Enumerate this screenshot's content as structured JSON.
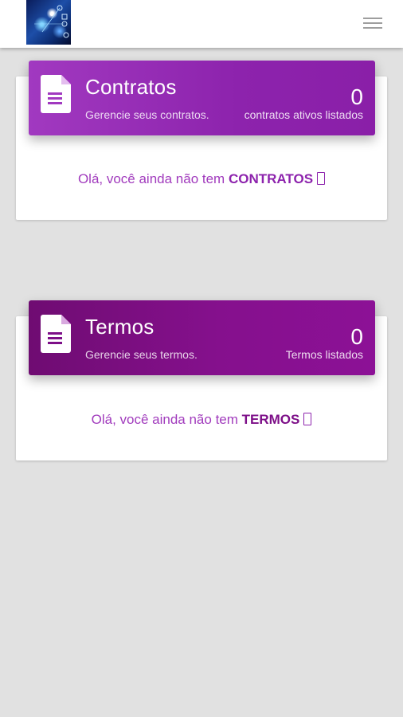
{
  "header": {
    "logo_icon": "app-logo",
    "menu_icon": "hamburger-menu-icon"
  },
  "cards": [
    {
      "id": "contratos",
      "title": "Contratos",
      "subtitle": "Gerencie seus contratos.",
      "count": "0",
      "count_label": "contratos ativos listados",
      "message_prefix": "Olá, você ainda não tem ",
      "message_highlight": "CONTRATOS",
      "icon": "document-icon",
      "header_color": "#9b32bc"
    },
    {
      "id": "termos",
      "title": "Termos",
      "subtitle": "Gerencie seus termos.",
      "count": "0",
      "count_label": "Termos listados",
      "message_prefix": "Olá, você ainda não tem ",
      "message_highlight": "TERMOS",
      "icon": "document-icon",
      "header_color": "#7d0f88"
    }
  ],
  "colors": {
    "background": "#e1e1e1",
    "accent_purple": "#a13bbd"
  }
}
